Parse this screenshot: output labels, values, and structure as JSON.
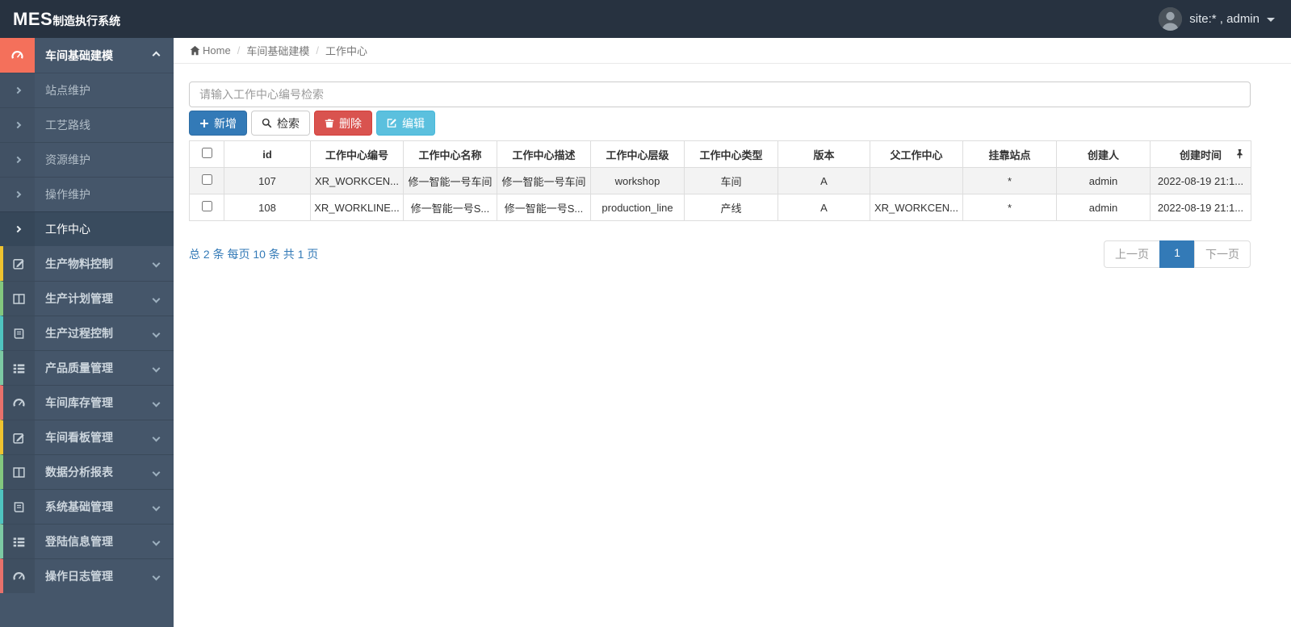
{
  "topbar": {
    "brand_bold": "MES",
    "brand_rest": "制造执行系统",
    "user_label": "site:* , admin"
  },
  "sidebar": {
    "active_section": {
      "label": "车间基础建模",
      "icon": "gauge-icon",
      "accent": "#f4705b"
    },
    "submenu": [
      {
        "label": "站点维护",
        "active": false
      },
      {
        "label": "工艺路线",
        "active": false
      },
      {
        "label": "资源维护",
        "active": false
      },
      {
        "label": "操作维护",
        "active": false
      },
      {
        "label": "工作中心",
        "active": true
      }
    ],
    "sections": [
      {
        "label": "生产物料控制",
        "icon": "pencil-square-icon",
        "accent": "#efc32f"
      },
      {
        "label": "生产计划管理",
        "icon": "columns-icon",
        "accent": "#83c77e"
      },
      {
        "label": "生产过程控制",
        "icon": "book-icon",
        "accent": "#4fc4c0"
      },
      {
        "label": "产品质量管理",
        "icon": "list-icon",
        "accent": "#7cc9a3"
      },
      {
        "label": "车间库存管理",
        "icon": "gauge-icon",
        "accent": "#e8716b"
      },
      {
        "label": "车间看板管理",
        "icon": "pencil-square-icon",
        "accent": "#efc32f"
      },
      {
        "label": "数据分析报表",
        "icon": "columns-icon",
        "accent": "#83c77e"
      },
      {
        "label": "系统基础管理",
        "icon": "book-icon",
        "accent": "#4fc4c0"
      },
      {
        "label": "登陆信息管理",
        "icon": "list-icon",
        "accent": "#7cc9a3"
      },
      {
        "label": "操作日志管理",
        "icon": "gauge-icon",
        "accent": "#e8716b"
      }
    ]
  },
  "breadcrumb": {
    "home": "Home",
    "items": [
      "车间基础建模",
      "工作中心"
    ]
  },
  "toolbar": {
    "search_placeholder": "请输入工作中心编号检索",
    "add_label": "新增",
    "search_label": "检索",
    "delete_label": "删除",
    "edit_label": "编辑"
  },
  "table": {
    "columns": [
      "id",
      "工作中心编号",
      "工作中心名称",
      "工作中心描述",
      "工作中心层级",
      "工作中心类型",
      "版本",
      "父工作中心",
      "挂靠站点",
      "创建人",
      "创建时间"
    ],
    "rows": [
      {
        "cells": [
          "107",
          "XR_WORKCEN...",
          "修一智能一号车间",
          "修一智能一号车间",
          "workshop",
          "车间",
          "A",
          "",
          "*",
          "admin",
          "2022-08-19 21:1..."
        ]
      },
      {
        "cells": [
          "108",
          "XR_WORKLINE...",
          "修一智能一号S...",
          "修一智能一号S...",
          "production_line",
          "产线",
          "A",
          "XR_WORKCEN...",
          "*",
          "admin",
          "2022-08-19 21:1..."
        ]
      }
    ]
  },
  "pagination": {
    "info": "总 2 条  每页 10 条  共 1 页",
    "prev_label": "上一页",
    "current_page": "1",
    "next_label": "下一页"
  },
  "colors": {
    "topbar": "#273240",
    "sidebar": "#45566a",
    "active_icon_block": "#f4705b",
    "primary": "#337ab7",
    "danger": "#d9534f",
    "info": "#5bc0de",
    "pager_active": "#337ab7"
  }
}
